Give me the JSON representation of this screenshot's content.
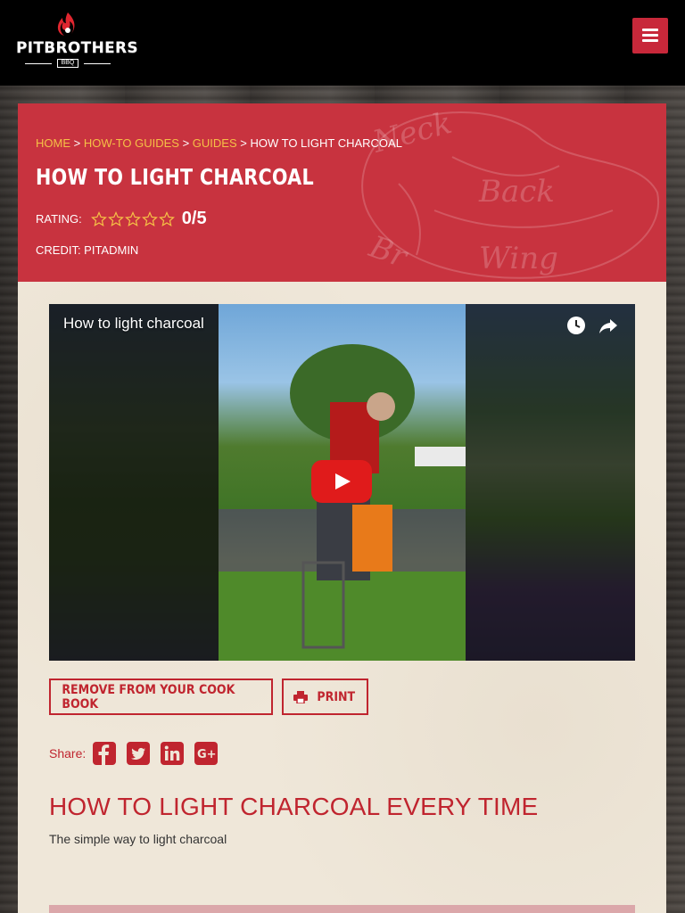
{
  "header": {
    "logo_text": "PITBROTHERS",
    "logo_sub": "BBQ",
    "menu_icon": "hamburger-icon"
  },
  "hero": {
    "breadcrumb": [
      {
        "label": "HOME",
        "link": true
      },
      {
        "label": "HOW-TO GUIDES",
        "link": true
      },
      {
        "label": "GUIDES",
        "link": true
      },
      {
        "label": "HOW TO LIGHT CHARCOAL",
        "link": false
      }
    ],
    "separator": " > ",
    "title": "HOW TO LIGHT CHARCOAL",
    "rating_label": "RATING:",
    "rating_value": 0,
    "rating_max": 5,
    "rating_text": "0/5",
    "credit": "CREDIT: PITADMIN",
    "deco_words": [
      "Neck",
      "Back",
      "Wing",
      "Br"
    ]
  },
  "video": {
    "title": "How to light charcoal",
    "icons": [
      "clock-icon",
      "share-arrow-icon",
      "play-icon"
    ]
  },
  "actions": {
    "remove_label": "REMOVE FROM YOUR COOK BOOK",
    "print_label": "PRINT"
  },
  "share": {
    "label": "Share:",
    "networks": [
      "facebook",
      "twitter",
      "linkedin",
      "google-plus"
    ]
  },
  "content": {
    "heading": "HOW TO LIGHT CHARCOAL EVERY TIME",
    "subtitle": "The simple way to light charcoal"
  },
  "colors": {
    "brand_red": "#c8333f",
    "link_gold": "#f5c046",
    "accent_red": "#c0252f",
    "youtube_red": "#e01b1b"
  }
}
